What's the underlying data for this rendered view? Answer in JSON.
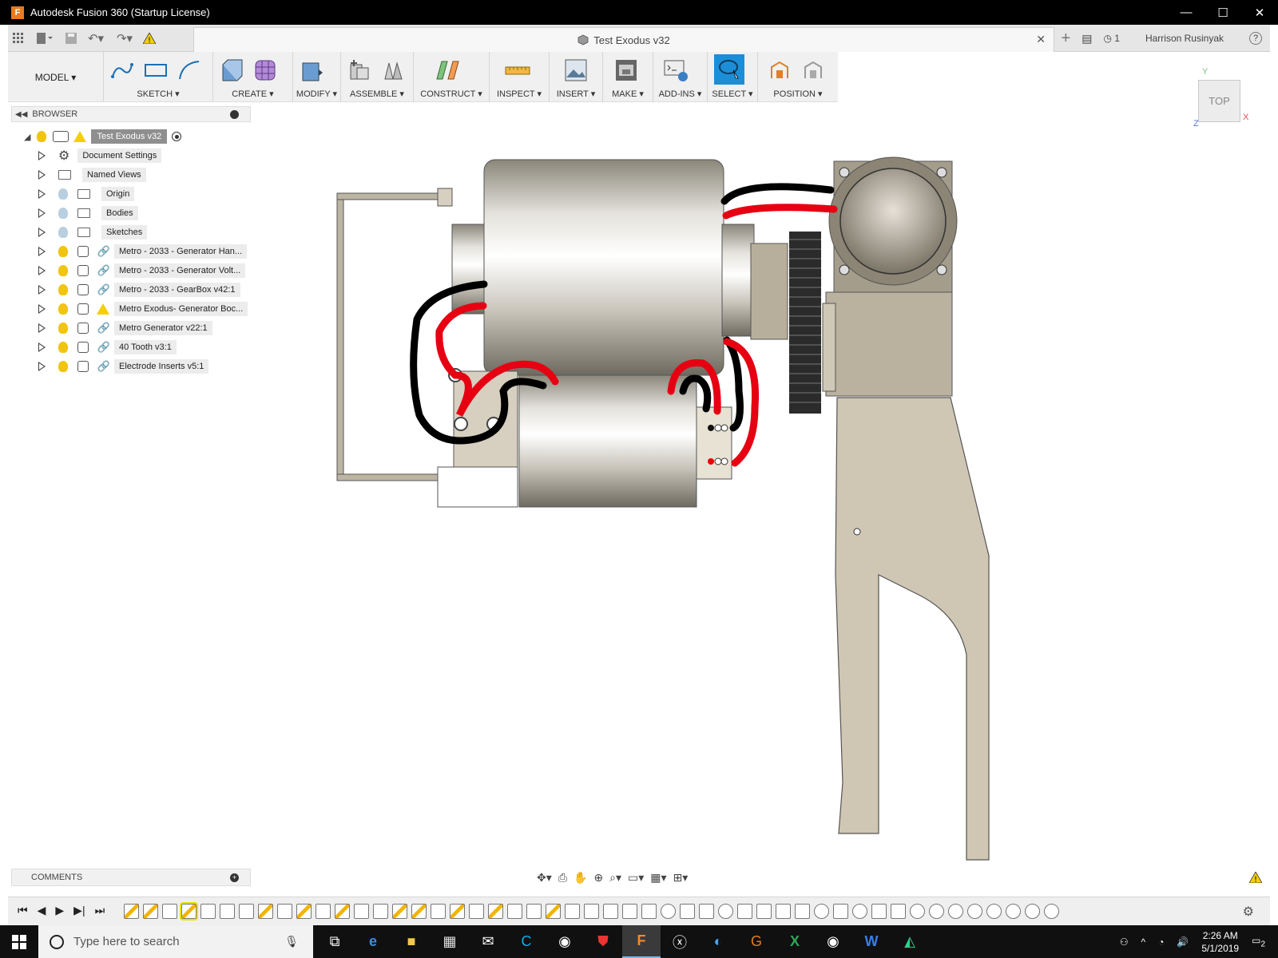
{
  "window": {
    "title": "Autodesk Fusion 360 (Startup License)",
    "minimize": "—",
    "maximize": "☐",
    "close": "✕"
  },
  "tabbar": {
    "doc_title": "Test Exodus v32",
    "close": "✕",
    "plus": "+",
    "jobs_count": "1",
    "user": "Harrison Rusinyak",
    "help": "?"
  },
  "toolbar": {
    "workspace": "MODEL ▾",
    "groups": [
      {
        "label": "SKETCH ▾"
      },
      {
        "label": "CREATE ▾"
      },
      {
        "label": "MODIFY ▾"
      },
      {
        "label": "ASSEMBLE ▾"
      },
      {
        "label": "CONSTRUCT ▾"
      },
      {
        "label": "INSPECT ▾"
      },
      {
        "label": "INSERT ▾"
      },
      {
        "label": "MAKE ▾"
      },
      {
        "label": "ADD-INS ▾"
      },
      {
        "label": "SELECT ▾"
      },
      {
        "label": "POSITION ▾"
      }
    ]
  },
  "viewcube": {
    "face": "TOP",
    "axis_x": "X",
    "axis_y": "Y",
    "axis_z": "Z"
  },
  "browser": {
    "header": "BROWSER",
    "root": "Test Exodus v32",
    "items": [
      {
        "label": "Document Settings",
        "icon": "gear-icon"
      },
      {
        "label": "Named Views",
        "icon": "folder-icon"
      },
      {
        "label": "Origin",
        "icon": "folder-icon"
      },
      {
        "label": "Bodies",
        "icon": "folder-icon"
      },
      {
        "label": "Sketches",
        "icon": "folder-icon"
      },
      {
        "label": "Metro - 2033 - Generator Han...",
        "icon": "link-icon"
      },
      {
        "label": "Metro - 2033 - Generator Volt...",
        "icon": "link-icon"
      },
      {
        "label": "Metro - 2033 - GearBox v42:1",
        "icon": "link-icon"
      },
      {
        "label": "Metro Exodus- Generator Boc...",
        "icon": "warning-icon"
      },
      {
        "label": "Metro Generator v22:1",
        "icon": "link-icon"
      },
      {
        "label": "40 Tooth v3:1",
        "icon": "link-icon"
      },
      {
        "label": "Electrode Inserts v5:1",
        "icon": "link-icon"
      }
    ]
  },
  "comments": {
    "label": "COMMENTS"
  },
  "taskbar": {
    "search_placeholder": "Type here to search",
    "time": "2:26 AM",
    "date": "5/1/2019",
    "notifications": "2"
  }
}
